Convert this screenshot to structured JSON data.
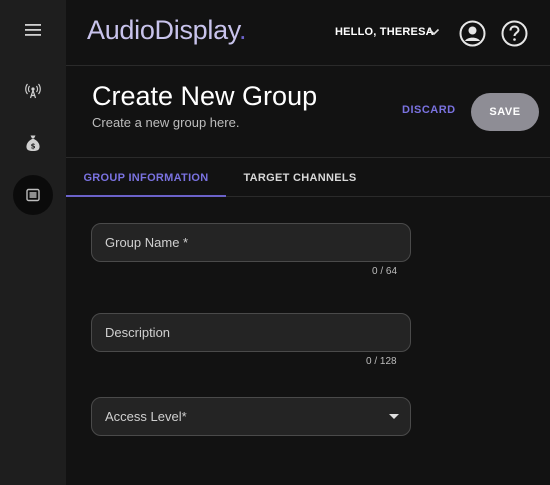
{
  "app": {
    "logo_main": "AudioDisplay",
    "logo_suffix": "."
  },
  "rail": {
    "items": [
      {
        "icon": "hamburger-menu-icon"
      },
      {
        "icon": "broadcast-icon"
      },
      {
        "icon": "money-bag-icon"
      },
      {
        "icon": "groups-icon",
        "active": true
      }
    ]
  },
  "topbar": {
    "greeting": "HELLO, THERESA",
    "account_icon": "account-circle-icon",
    "help_icon": "help-circle-icon"
  },
  "page": {
    "title": "Create New Group",
    "subtitle": "Create a new group here.",
    "discard_label": "DISCARD",
    "save_label": "SAVE"
  },
  "tabs": [
    {
      "label": "GROUP INFORMATION",
      "active": true
    },
    {
      "label": "TARGET CHANNELS",
      "active": false
    }
  ],
  "form": {
    "group_name": {
      "label": "Group Name *",
      "value": "",
      "counter": "0 / 64"
    },
    "description": {
      "label": "Description",
      "value": "",
      "counter": "0 / 128"
    },
    "access_level": {
      "label": "Access Level*",
      "value": ""
    }
  },
  "colors": {
    "accent": "#6b62c9",
    "accent_text": "#7a72e0",
    "logo": "#c8c3ec",
    "save_bg": "#8e8d95"
  }
}
